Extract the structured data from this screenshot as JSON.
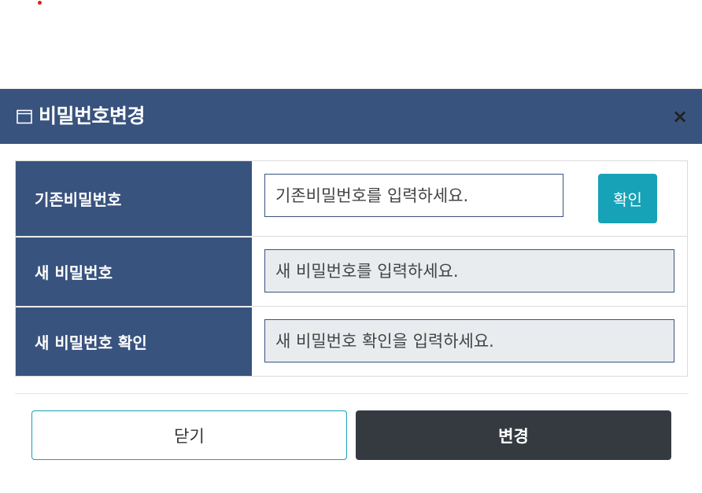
{
  "modal": {
    "title": "비밀번호변경",
    "close_label": "×"
  },
  "fields": {
    "current_password": {
      "label": "기존비밀번호",
      "placeholder": "기존비밀번호를 입력하세요.",
      "confirm_label": "확인"
    },
    "new_password": {
      "label": "새 비밀번호",
      "placeholder": "새 비밀번호를 입력하세요."
    },
    "confirm_password": {
      "label": "새 비밀번호 확인",
      "placeholder": "새 비밀번호 확인을 입력하세요."
    }
  },
  "footer": {
    "close_label": "닫기",
    "change_label": "변경"
  },
  "colors": {
    "header_bg": "#39537f",
    "accent": "#17a2b8",
    "dark_button": "#343a40",
    "disabled_input": "#e9ecef"
  },
  "icons": {
    "title_icon": "window-icon",
    "close_icon": "close-icon"
  }
}
